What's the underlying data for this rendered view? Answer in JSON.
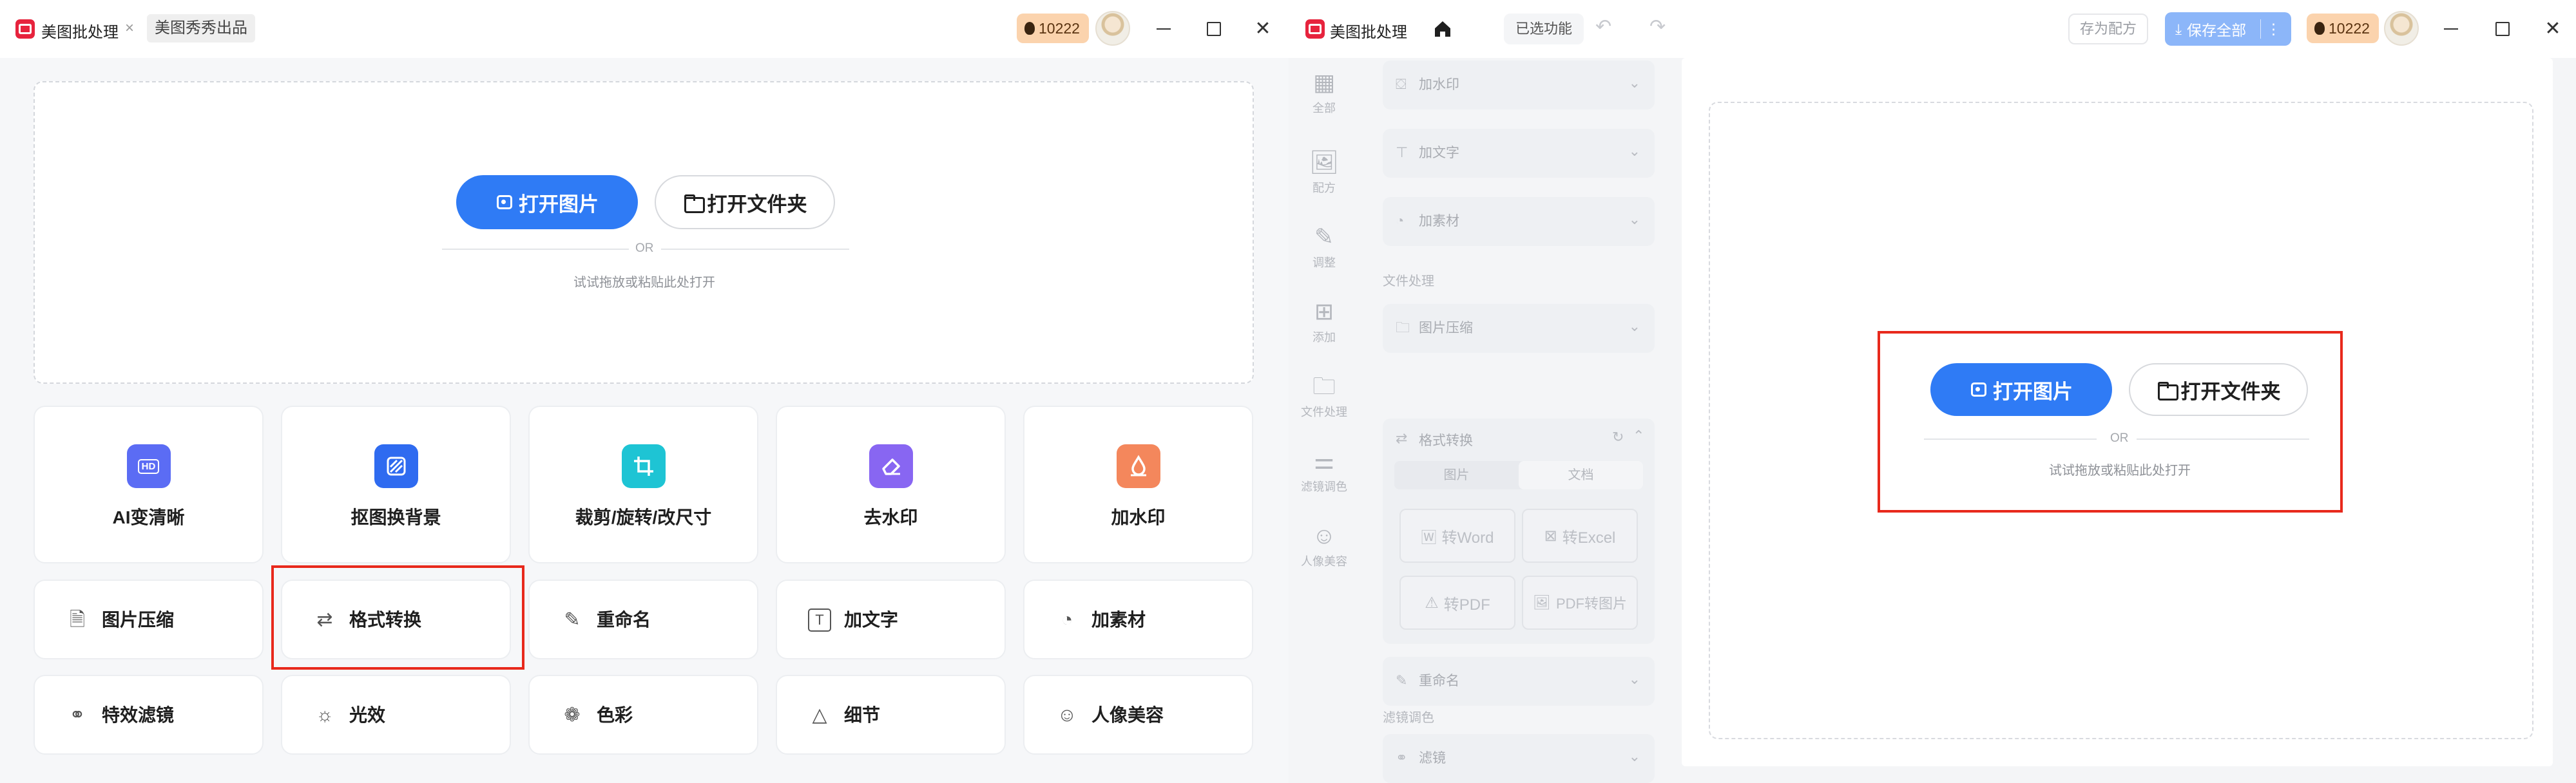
{
  "left_window": {
    "app_title": "美图批处理",
    "tab_secondary": "美图秀秀出品",
    "tab_close_glyph": "×",
    "coins": "10222",
    "drop_zone": {
      "open_image": "打开图片",
      "open_folder": "打开文件夹",
      "or_text": "OR",
      "hint": "试试拖放或粘贴此处打开"
    },
    "feature_cards": [
      {
        "label": "AI变清晰",
        "icon": "hd-icon",
        "icon_text": "HD",
        "color": "#5b6cf4"
      },
      {
        "label": "抠图换背景",
        "icon": "cutout-icon",
        "icon_text": "",
        "color": "#2f6bf0"
      },
      {
        "label": "裁剪/旋转/改尺寸",
        "icon": "crop-icon",
        "icon_text": "",
        "color": "#1ec4d4"
      },
      {
        "label": "去水印",
        "icon": "eraser-icon",
        "icon_text": "",
        "color": "#8866f2"
      },
      {
        "label": "加水印",
        "icon": "watermark-icon",
        "icon_text": "",
        "color": "#f4875c"
      }
    ],
    "tools_row1": [
      {
        "label": "图片压缩",
        "icon": "compress-icon",
        "glyph": "🗎"
      },
      {
        "label": "格式转换",
        "icon": "convert-icon",
        "glyph": "⇄"
      },
      {
        "label": "重命名",
        "icon": "rename-icon",
        "glyph": "✎"
      },
      {
        "label": "加文字",
        "icon": "text-icon",
        "glyph": "T"
      },
      {
        "label": "加素材",
        "icon": "sticker-icon",
        "glyph": "◔"
      }
    ],
    "tools_row2": [
      {
        "label": "特效滤镜",
        "icon": "filter-icon",
        "glyph": "⚭"
      },
      {
        "label": "光效",
        "icon": "light-icon",
        "glyph": "☼"
      },
      {
        "label": "色彩",
        "icon": "color-icon",
        "glyph": "❁"
      },
      {
        "label": "细节",
        "icon": "detail-icon",
        "glyph": "△"
      },
      {
        "label": "人像美容",
        "icon": "portrait-icon",
        "glyph": "☺"
      }
    ]
  },
  "right_window": {
    "app_title": "美图批处理",
    "selected_features": "已选功能",
    "save_recipe": "存为配方",
    "save_all": "保存全部",
    "coins": "10222",
    "side_nav": [
      {
        "label": "全部",
        "icon": "grid-icon",
        "glyph": "▦"
      },
      {
        "label": "配方",
        "icon": "recipe-icon",
        "glyph": "🖼"
      },
      {
        "label": "调整",
        "icon": "adjust-icon",
        "glyph": "✎"
      },
      {
        "label": "添加",
        "icon": "add-icon",
        "glyph": "⊞"
      },
      {
        "label": "文件处理",
        "icon": "folder-icon",
        "glyph": "🗀"
      },
      {
        "label": "滤镜调色",
        "icon": "sliders-icon",
        "glyph": "⚌"
      },
      {
        "label": "人像美容",
        "icon": "portrait-icon",
        "glyph": "☺"
      }
    ],
    "panel": {
      "rows_top": [
        "加水印",
        "加文字",
        "加素材"
      ],
      "section_file": "文件处理",
      "row_compress": "图片压缩",
      "format_title": "格式转换",
      "seg_image": "图片",
      "seg_doc": "文档",
      "formats": [
        "转Word",
        "转Excel",
        "转PDF",
        "PDF转图片"
      ],
      "row_rename": "重命名",
      "section_filter": "滤镜调色",
      "row_filter": "滤镜"
    },
    "canvas": {
      "open_image": "打开图片",
      "open_folder": "打开文件夹",
      "or_text": "OR",
      "hint": "试试拖放或粘贴此处打开"
    }
  }
}
